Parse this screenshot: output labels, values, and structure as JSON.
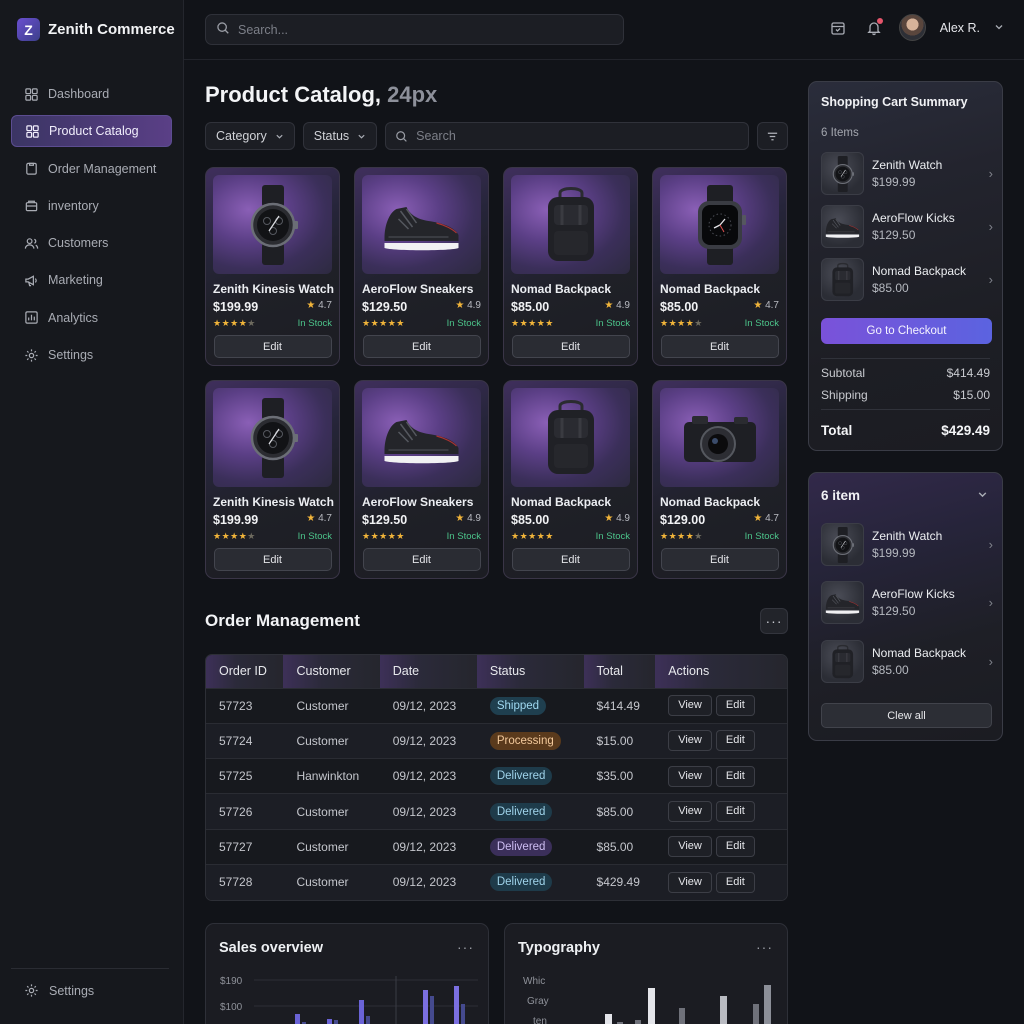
{
  "brand": {
    "logo_letter": "Z",
    "name": "Zenith Commerce"
  },
  "nav": {
    "items": [
      {
        "label": "Dashboard",
        "icon": "grid-icon"
      },
      {
        "label": "Product Catalog",
        "icon": "grid-icon",
        "active": true
      },
      {
        "label": "Order Management",
        "icon": "clipboard-icon"
      },
      {
        "label": "inventory",
        "icon": "box-icon"
      },
      {
        "label": "Customers",
        "icon": "users-icon"
      },
      {
        "label": "Marketing",
        "icon": "megaphone-icon"
      },
      {
        "label": "Analytics",
        "icon": "chart-icon"
      },
      {
        "label": "Settings",
        "icon": "gear-icon"
      }
    ],
    "bottom_label": "Settings"
  },
  "header": {
    "search_placeholder": "Search...",
    "user_name": "Alex R."
  },
  "page": {
    "title": "Product Catalog,",
    "title_muted": "24px"
  },
  "filters": {
    "category": "Category",
    "status": "Status",
    "search_placeholder": "Search"
  },
  "products": [
    {
      "name": "Zenith Kinesis Watch",
      "price": "$199.99",
      "rating": "4.7",
      "stars": 4.5,
      "stock": "In Stock",
      "edit": "Edit",
      "image": "watch"
    },
    {
      "name": "AeroFlow Sneakers",
      "price": "$129.50",
      "rating": "4.9",
      "stars": 5,
      "stock": "In Stock",
      "edit": "Edit",
      "image": "sneaker"
    },
    {
      "name": "Nomad Backpack",
      "price": "$85.00",
      "rating": "4.9",
      "stars": 5,
      "stock": "In Stock",
      "edit": "Edit",
      "image": "backpack"
    },
    {
      "name": "Nomad Backpack",
      "price": "$85.00",
      "rating": "4.7",
      "stars": 4.5,
      "stock": "In Stock",
      "edit": "Edit",
      "image": "smartwatch"
    },
    {
      "name": "Zenith Kinesis Watch",
      "price": "$199.99",
      "rating": "4.7",
      "stars": 4.5,
      "stock": "In Stock",
      "edit": "Edit",
      "image": "watch"
    },
    {
      "name": "AeroFlow Sneakers",
      "price": "$129.50",
      "rating": "4.9",
      "stars": 5,
      "stock": "In Stock",
      "edit": "Edit",
      "image": "sneaker"
    },
    {
      "name": "Nomad Backpack",
      "price": "$85.00",
      "rating": "4.9",
      "stars": 5,
      "stock": "In Stock",
      "edit": "Edit",
      "image": "backpack"
    },
    {
      "name": "Nomad Backpack",
      "price": "$129.00",
      "rating": "4.7",
      "stars": 4,
      "stock": "In Stock",
      "edit": "Edit",
      "image": "camera"
    }
  ],
  "orders": {
    "title": "Order Management",
    "columns": [
      "Order ID",
      "Customer",
      "Date",
      "Status",
      "Total",
      "Actions"
    ],
    "view_label": "View",
    "edit_label": "Edit",
    "rows": [
      {
        "id": "57723",
        "customer": "Customer",
        "date": "09/12, 2023",
        "status": "Shipped",
        "status_kind": "shipped",
        "total": "$414.49"
      },
      {
        "id": "57724",
        "customer": "Customer",
        "date": "09/12, 2023",
        "status": "Processing",
        "status_kind": "processing",
        "total": "$15.00"
      },
      {
        "id": "57725",
        "customer": "Hanwinkton",
        "date": "09/12, 2023",
        "status": "Delivered",
        "status_kind": "delivered",
        "total": "$35.00"
      },
      {
        "id": "57726",
        "customer": "Customer",
        "date": "09/12, 2023",
        "status": "Delivered",
        "status_kind": "delivered",
        "total": "$85.00"
      },
      {
        "id": "57727",
        "customer": "Customer",
        "date": "09/12, 2023",
        "status": "Delivered",
        "status_kind": "delivered2",
        "total": "$85.00"
      },
      {
        "id": "57728",
        "customer": "Customer",
        "date": "09/12, 2023",
        "status": "Delivered",
        "status_kind": "delivered",
        "total": "$429.49"
      }
    ]
  },
  "sales": {
    "title": "Sales overview",
    "y_labels": [
      "$190",
      "$100"
    ]
  },
  "typography": {
    "title": "Typography",
    "labels": [
      "Whic",
      "Gray",
      "ten"
    ]
  },
  "cart": {
    "title": "Shopping Cart Summary",
    "count": "6 Items",
    "items": [
      {
        "name": "Zenith Watch",
        "price": "$199.99",
        "image": "watch"
      },
      {
        "name": "AeroFlow Kicks",
        "price": "$129.50",
        "image": "sneaker"
      },
      {
        "name": "Nomad Backpack",
        "price": "$85.00",
        "image": "backpack"
      }
    ],
    "checkout": "Go to Checkout",
    "subtotal_label": "Subtotal",
    "subtotal": "$414.49",
    "shipping_label": "Shipping",
    "shipping": "$15.00",
    "total_label": "Total",
    "total": "$429.49"
  },
  "cart2": {
    "title": "6 item",
    "items": [
      {
        "name": "Zenith Watch",
        "price": "$199.99",
        "image": "watch"
      },
      {
        "name": "AeroFlow Kicks",
        "price": "$129.50",
        "image": "sneaker"
      },
      {
        "name": "Nomad Backpack",
        "price": "$85.00",
        "image": "backpack"
      }
    ],
    "clear": "Clew all"
  },
  "colors": {
    "accent": "#7a52d9",
    "in_stock": "#4cc38a",
    "star": "#f2b53a"
  }
}
